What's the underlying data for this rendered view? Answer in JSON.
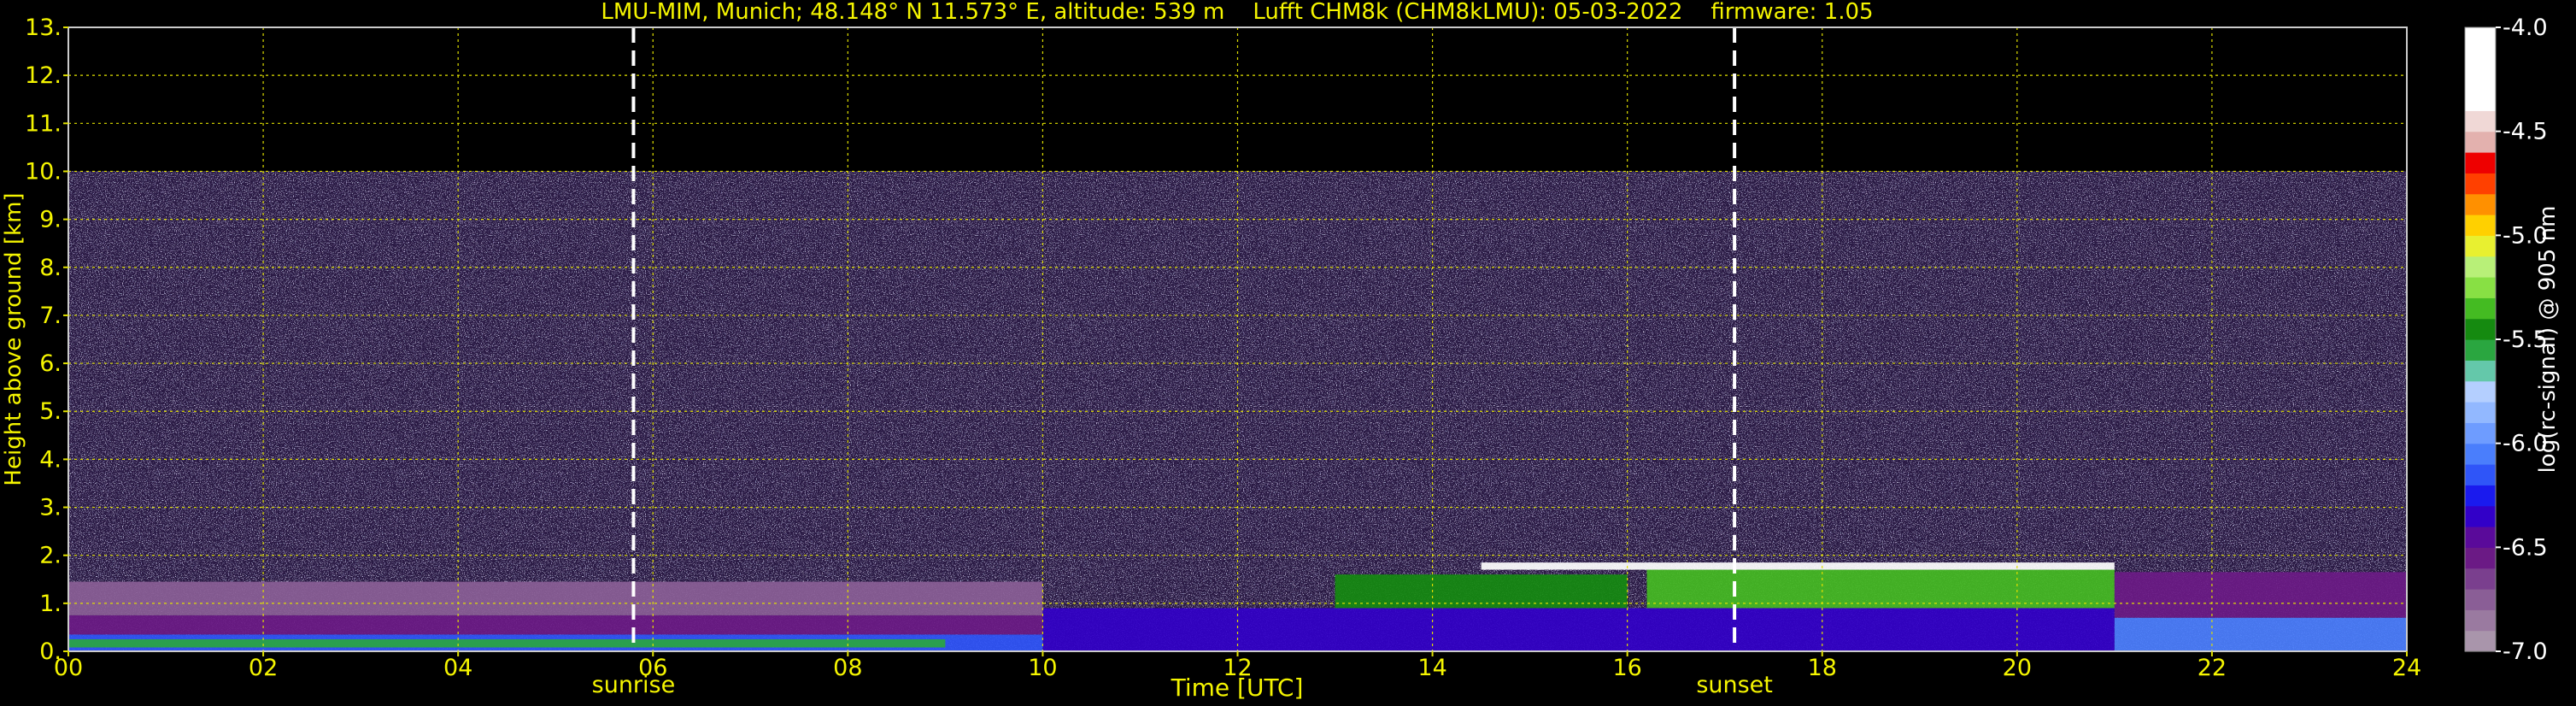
{
  "chart_data": {
    "type": "heatmap",
    "title": "LMU-MIM, Munich; 48.148° N 11.573° E, altitude: 539 m    Lufft CHM8k (CHM8kLMU): 05-03-2022    firmware: 1.05",
    "xlabel": "Time [UTC]",
    "ylabel": "Height above ground [km]",
    "xlim": [
      0,
      24
    ],
    "ylim": [
      0,
      13
    ],
    "x_ticks": [
      "00",
      "02",
      "04",
      "06",
      "08",
      "10",
      "12",
      "14",
      "16",
      "18",
      "20",
      "22",
      "24"
    ],
    "y_ticks": [
      "0.",
      "1.",
      "2.",
      "3.",
      "4.",
      "5.",
      "6.",
      "7.",
      "8.",
      "9.",
      "10.",
      "11.",
      "12.",
      "13."
    ],
    "grid": true,
    "data_top_km": 10,
    "markers": [
      {
        "label": "sunrise",
        "x": 5.8
      },
      {
        "label": "sunset",
        "x": 17.1
      }
    ],
    "colorbar": {
      "label": "log(rc-signal) @ 905 nm",
      "range": [
        -7.0,
        -4.0
      ],
      "ticks": [
        "-4.0",
        "-4.5",
        "-5.0",
        "-5.5",
        "-6.0",
        "-6.5",
        "-7.0"
      ],
      "colors": [
        "#a995ab",
        "#9a7aa0",
        "#8a5e96",
        "#7a3f8e",
        "#6b1a85",
        "#5a0a9a",
        "#3200c8",
        "#1a1aee",
        "#2f55f8",
        "#4a7efc",
        "#6e9cff",
        "#92b8ff",
        "#b4cfff",
        "#64c8aa",
        "#2aa640",
        "#158a10",
        "#44bb22",
        "#88e044",
        "#b8f078",
        "#e8f030",
        "#ffd000",
        "#ff9000",
        "#ff4000",
        "#ee0000",
        "#e3b1ae",
        "#f0d8d6",
        "#ffffff",
        "#ffffff",
        "#ffffff",
        "#ffffff"
      ]
    },
    "layers": [
      {
        "t0": 0,
        "t1": 10,
        "h0": 0.0,
        "h1": 0.35,
        "color": "#2f55f8"
      },
      {
        "t0": 0,
        "t1": 10,
        "h0": 0.35,
        "h1": 0.75,
        "color": "#6b1a85"
      },
      {
        "t0": 0,
        "t1": 10,
        "h0": 0.75,
        "h1": 1.45,
        "color": "#8a5e96"
      },
      {
        "t0": 0,
        "t1": 9,
        "h0": 0.08,
        "h1": 0.25,
        "color": "#2aa640"
      },
      {
        "t0": 10,
        "t1": 21,
        "h0": 0.0,
        "h1": 0.9,
        "color": "#3200c8"
      },
      {
        "t0": 13,
        "t1": 16,
        "h0": 0.9,
        "h1": 1.6,
        "color": "#158a10"
      },
      {
        "t0": 16.2,
        "t1": 21,
        "h0": 0.9,
        "h1": 1.7,
        "color": "#44bb22"
      },
      {
        "t0": 14.5,
        "t1": 21,
        "h0": 1.7,
        "h1": 1.85,
        "color": "#ffffff"
      },
      {
        "t0": 21,
        "t1": 24,
        "h0": 0.0,
        "h1": 0.7,
        "color": "#4a7efc"
      },
      {
        "t0": 21,
        "t1": 24,
        "h0": 0.7,
        "h1": 1.65,
        "color": "#6b1a85"
      }
    ]
  }
}
